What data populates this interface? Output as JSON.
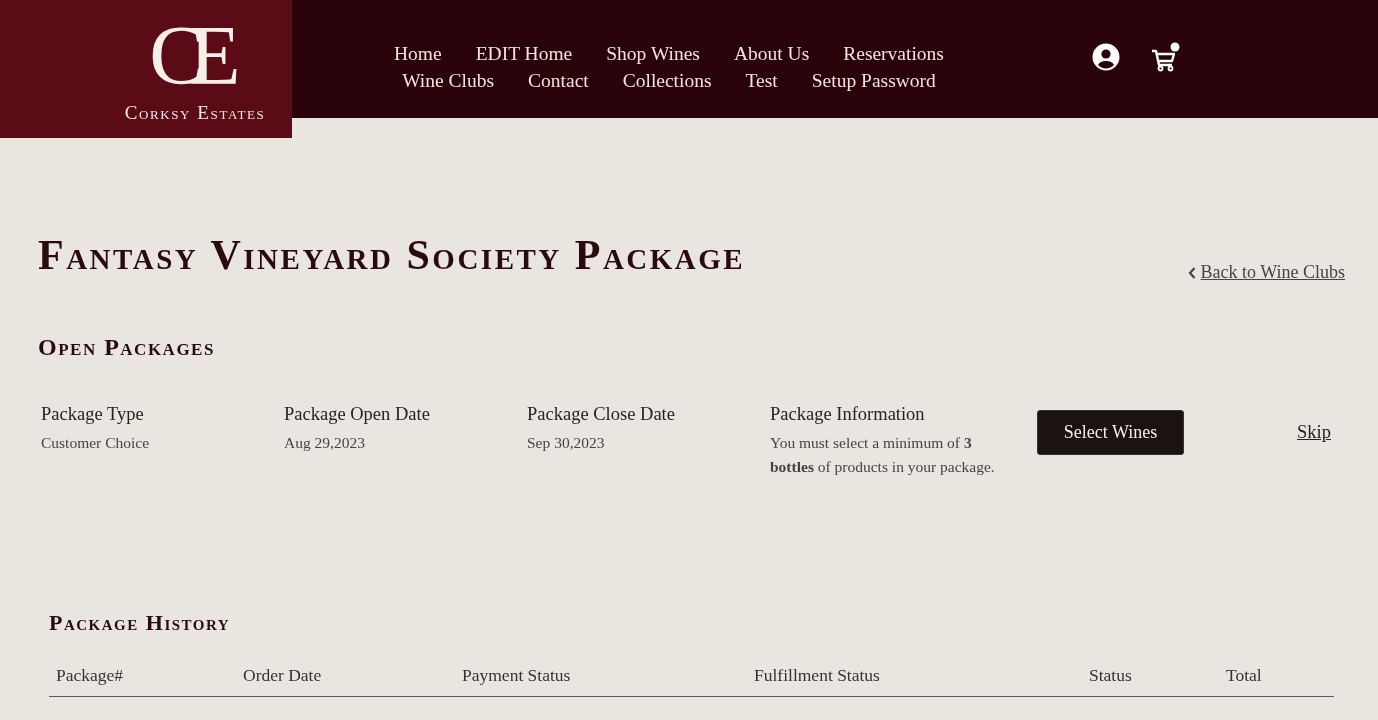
{
  "header": {
    "logo": {
      "monogram": "CE",
      "name": "Corksy Estates"
    },
    "nav_rows": [
      {
        "items": [
          "Home",
          "EDIT Home",
          "Shop Wines",
          "About Us",
          "Reservations"
        ]
      },
      {
        "items": [
          "Wine Clubs",
          "Contact",
          "Collections",
          "Test",
          "Setup Password"
        ]
      }
    ]
  },
  "page": {
    "title": "Fantasy Vineyard Society Package",
    "back_link": "Back to Wine Clubs"
  },
  "open_packages": {
    "heading": "Open Packages",
    "packages": [
      {
        "fields": [
          {
            "label": "Package Type",
            "value": "Customer Choice"
          },
          {
            "label": "Package Open Date",
            "value": "Aug 29,2023"
          },
          {
            "label": "Package Close Date",
            "value": "Sep 30,2023"
          },
          {
            "label": "Package Information",
            "value": "You must select a minimum of **3 bottles** of products in your package."
          }
        ],
        "action": "Select Wines",
        "skip": "Skip"
      }
    ]
  },
  "package_history": {
    "heading": "Package History",
    "columns": [
      "Package#",
      "Order Date",
      "Payment Status",
      "Fulfillment Status",
      "Status",
      "Total"
    ]
  }
}
